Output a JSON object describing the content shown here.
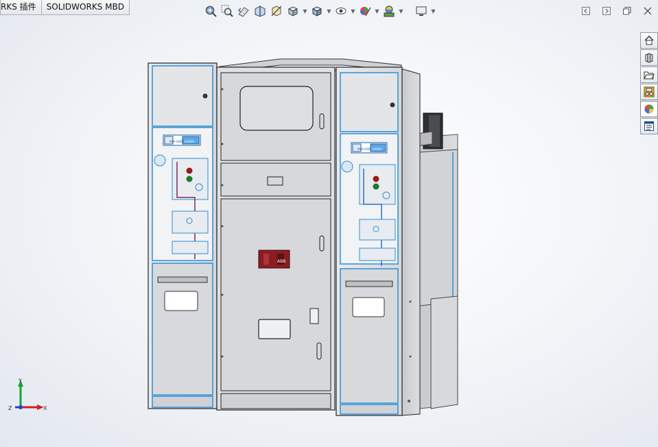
{
  "window": {
    "tabs": [
      {
        "label": "RKS 插件"
      },
      {
        "label": "SOLIDWORKS MBD"
      }
    ]
  },
  "hud_toolbar": {
    "items": [
      {
        "icon": "zoom-to-fit-icon"
      },
      {
        "icon": "zoom-to-area-icon"
      },
      {
        "icon": "previous-view-icon"
      },
      {
        "icon": "section-view-icon"
      },
      {
        "icon": "dynamic-annotation-views-icon"
      },
      {
        "icon": "view-orientation-icon"
      },
      {
        "icon": "display-style-icon"
      },
      {
        "icon": "hide-show-items-icon"
      },
      {
        "icon": "edit-appearance-icon"
      },
      {
        "icon": "apply-scene-icon"
      },
      {
        "icon": "view-settings-icon"
      }
    ]
  },
  "window_controls": [
    "tile-left-icon",
    "tile-right-icon",
    "restore-icon",
    "close-icon"
  ],
  "task_pane": [
    "solidworks-resources-icon",
    "design-library-icon",
    "file-explorer-icon",
    "view-palette-icon",
    "appearances-scenes-icon",
    "custom-properties-icon"
  ],
  "triad": {
    "x_label": "X",
    "y_label": "Y",
    "z_label": "Z"
  },
  "model": {
    "left_panel": {
      "label_left": "MM-G600",
      "label_right": "G300A"
    },
    "right_panel": {
      "label_left": "MM-G600",
      "label_right": "G300A"
    },
    "center_badge": "ABB"
  },
  "colors": {
    "edge_highlight": "#2b8fd6",
    "panel_fill": "#dcdde0",
    "red_lock": "#8c1c22",
    "axis_x": "#d11f1f",
    "axis_y": "#16a336",
    "axis_z": "#1f3fd1"
  }
}
